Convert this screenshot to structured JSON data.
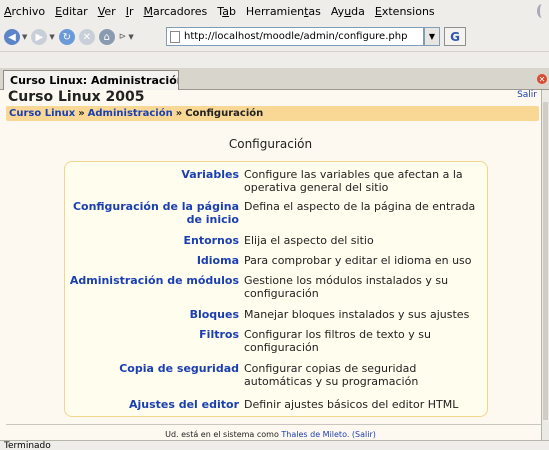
{
  "menubar": {
    "items": [
      {
        "label": "Archivo",
        "u": "A",
        "rest": "rchivo"
      },
      {
        "label": "Editar",
        "u": "E",
        "rest": "ditar"
      },
      {
        "label": "Ver",
        "u": "V",
        "rest": "er"
      },
      {
        "label": "Ir",
        "u": "I",
        "rest": "r"
      },
      {
        "label": "Marcadores",
        "u": "M",
        "rest": "arcadores"
      },
      {
        "label": "Tab",
        "pre": "T",
        "u": "a",
        "rest": "b"
      },
      {
        "label": "Herramientas",
        "pre": "Herramien",
        "u": "t",
        "rest": "as"
      },
      {
        "label": "Ayuda",
        "pre": "Ay",
        "u": "u",
        "rest": "da"
      },
      {
        "label": "Extensions",
        "u": "E",
        "rest": "xtensions"
      }
    ]
  },
  "navbar": {
    "url": "http://localhost/moodle/admin/configure.php"
  },
  "tab": {
    "title": "Curso Linux: Administración..."
  },
  "header": {
    "site_title": "Curso Linux 2005",
    "logout": "Salir"
  },
  "breadcrumb": {
    "items": [
      "Curso Linux",
      "Administración",
      "Configuración"
    ],
    "separator": "»"
  },
  "main": {
    "title": "Configuración",
    "rows": [
      {
        "label": "Variables",
        "desc": "Configure las variables que afectan a la operativa general del sitio"
      },
      {
        "label": "Configuración de la página de inicio",
        "desc": "Defina el aspecto de la página de entrada"
      },
      {
        "label": "Entornos",
        "desc": "Elija el aspecto del sitio"
      },
      {
        "label": "Idioma",
        "desc": "Para comprobar y editar el idioma en uso"
      },
      {
        "label": "Administración de módulos",
        "desc": "Gestione los módulos instalados y su configuración"
      },
      {
        "label": "Bloques",
        "desc": "Manejar bloques instalados y sus ajustes"
      },
      {
        "label": "Filtros",
        "desc": "Configurar los filtros de texto y su configuración"
      },
      {
        "label": "Copia de seguridad",
        "desc": "Configurar copias de seguridad automáticas y su programación"
      },
      {
        "label": "Ajustes del editor",
        "desc": "Definir ajustes básicos del editor HTML"
      }
    ]
  },
  "footer": {
    "prefix": "Ud. está en el sistema como",
    "user": "Thales de Mileto.",
    "logout": "(Salir)"
  },
  "status": {
    "text": "Terminado"
  },
  "colors": {
    "link": "#1a3fb0",
    "breadcrumb_bg": "#f9d896",
    "page_bg": "#fef9f0",
    "box_border": "#f2d68c"
  }
}
